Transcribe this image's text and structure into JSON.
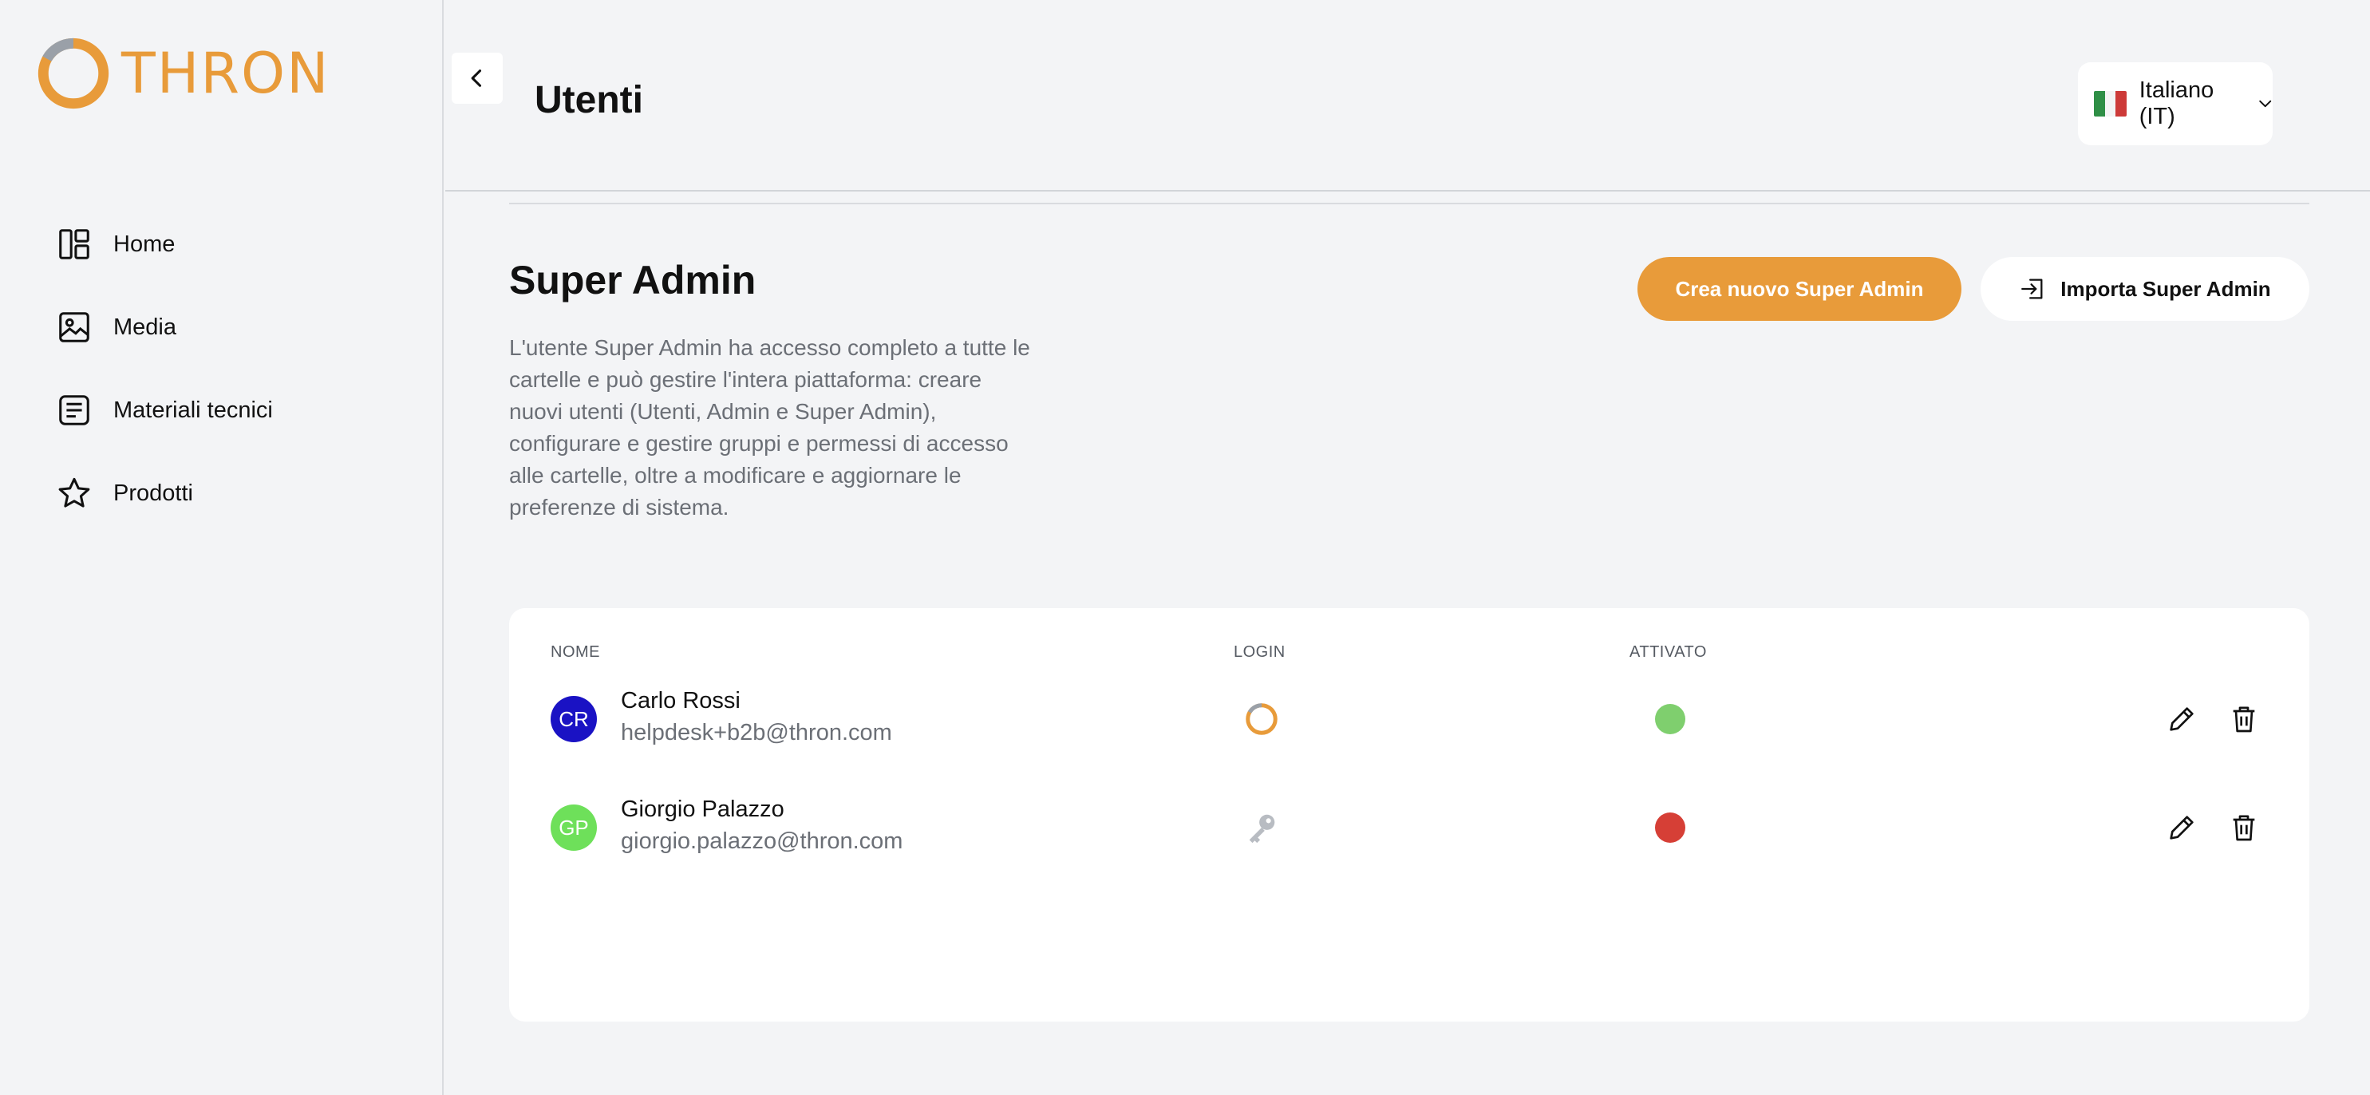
{
  "brand": {
    "logo_text": "THRON",
    "accent": "#e89b3a"
  },
  "sidebar": {
    "items": [
      {
        "label": "Home",
        "icon": "dashboard-icon"
      },
      {
        "label": "Media",
        "icon": "image-icon"
      },
      {
        "label": "Materiali tecnici",
        "icon": "document-icon"
      },
      {
        "label": "Prodotti",
        "icon": "star-icon"
      }
    ]
  },
  "header": {
    "title": "Utenti",
    "language": "Italiano (IT)"
  },
  "section": {
    "title": "Super Admin",
    "description": "L'utente Super Admin ha accesso completo a tutte le cartelle e può gestire l'intera piattaforma: creare nuovi utenti (Utenti, Admin e Super Admin), configurare e gestire gruppi e permessi di accesso alle cartelle, oltre a modificare e aggiornare le preferenze di sistema.",
    "create_button": "Crea nuovo Super Admin",
    "import_button": "Importa Super Admin"
  },
  "table": {
    "columns": {
      "name": "NOME",
      "login": "LOGIN",
      "activated": "ATTIVATO"
    },
    "rows": [
      {
        "initials": "CR",
        "avatar_color": "#1a12c4",
        "name": "Carlo Rossi",
        "email": "helpdesk+b2b@thron.com",
        "login_icon": "loading-ring-icon",
        "activated": true,
        "status_color": "#7fcf6e"
      },
      {
        "initials": "GP",
        "avatar_color": "#6ee05a",
        "name": "Giorgio Palazzo",
        "email": "giorgio.palazzo@thron.com",
        "login_icon": "key-icon",
        "activated": false,
        "status_color": "#d63f36"
      }
    ]
  }
}
